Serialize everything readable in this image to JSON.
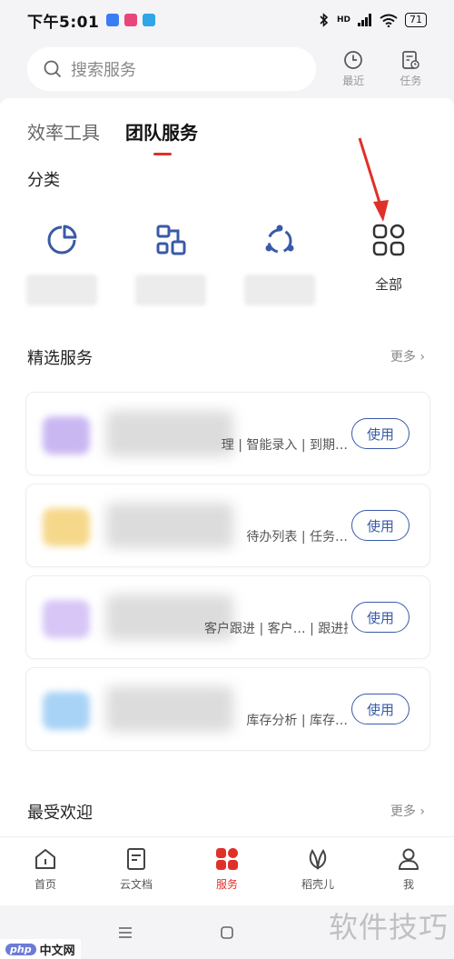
{
  "status": {
    "time": "下午5:01",
    "battery": "71",
    "network": "HD"
  },
  "search": {
    "placeholder": "搜索服务"
  },
  "header_tools": [
    {
      "label": "最近",
      "icon": "clock-icon"
    },
    {
      "label": "任务",
      "icon": "task-icon"
    }
  ],
  "tabs": [
    {
      "label": "效率工具",
      "active": false
    },
    {
      "label": "团队服务",
      "active": true
    }
  ],
  "categories": {
    "title": "分类",
    "items": [
      {
        "icon": "pie-chart-icon",
        "label": ""
      },
      {
        "icon": "flow-icon",
        "label": ""
      },
      {
        "icon": "cycle-icon",
        "label": ""
      },
      {
        "icon": "grid-icon",
        "label": "全部"
      }
    ]
  },
  "featured": {
    "title": "精选服务",
    "more": "更多",
    "items": [
      {
        "desc": "理 | 智能录入 | 到期…",
        "button": "使用",
        "thumb_color": "#c9b7f2"
      },
      {
        "desc": "待办列表 | 任务…",
        "button": "使用",
        "thumb_color": "#f6d88a"
      },
      {
        "desc": "客户跟进 | 客户… | 跟进提醒 | 跟…",
        "button": "使用",
        "thumb_color": "#d7c6f6"
      },
      {
        "desc": "库存分析 | 库存…",
        "button": "使用",
        "thumb_color": "#a9d3f6"
      }
    ]
  },
  "popular": {
    "title": "最受欢迎",
    "more": "更多"
  },
  "bottom_nav": [
    {
      "label": "首页",
      "icon": "home-icon",
      "active": false
    },
    {
      "label": "云文档",
      "icon": "document-icon",
      "active": false
    },
    {
      "label": "服务",
      "icon": "services-icon",
      "active": true
    },
    {
      "label": "稻壳儿",
      "icon": "leaf-icon",
      "active": false
    },
    {
      "label": "我",
      "icon": "profile-icon",
      "active": false
    }
  ],
  "watermark": "软件技巧",
  "site_badge": {
    "php": "php",
    "name": "中文网"
  },
  "colors": {
    "accent": "#e0302a",
    "button": "#3a5aa7",
    "arrow": "#e0302a"
  }
}
